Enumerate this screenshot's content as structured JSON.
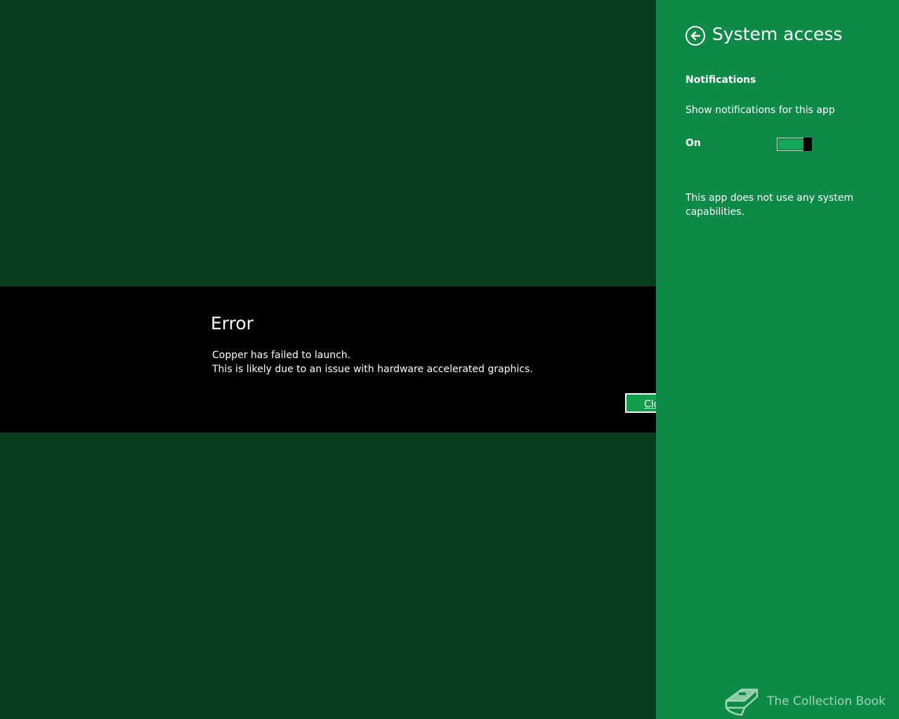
{
  "error_dialog": {
    "title": "Error",
    "line1": "Copper has failed to launch.",
    "line2": "This is likely due to an issue with hardware accelerated graphics.",
    "button_label": "Close"
  },
  "settings_pane": {
    "title": "System access",
    "back_icon": "back-arrow-circle-icon",
    "section_heading": "Notifications",
    "notification_label": "Show notifications for this app",
    "toggle_state": "On",
    "toggle_on": true,
    "capabilities_text": "This app does not use any system capabilities."
  },
  "watermark": {
    "text": "The Collection Book",
    "icon": "book-icon"
  },
  "colors": {
    "app_background": "#083d20",
    "pane_background": "#0e8a48",
    "error_band": "#000000",
    "button_accent": "#109e4b"
  }
}
